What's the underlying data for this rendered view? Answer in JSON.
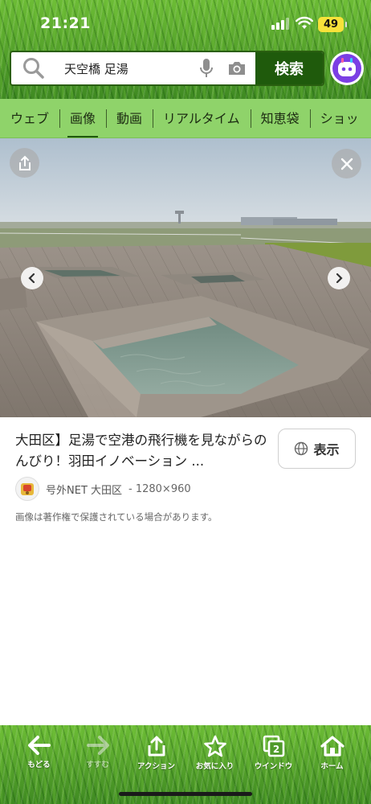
{
  "status_bar": {
    "time": "21:21",
    "battery": "49"
  },
  "search": {
    "query": "天空橋 足湯",
    "button_label": "検索"
  },
  "tabs": [
    {
      "label": "ウェブ",
      "active": false
    },
    {
      "label": "画像",
      "active": true
    },
    {
      "label": "動画",
      "active": false
    },
    {
      "label": "リアルタイム",
      "active": false
    },
    {
      "label": "知恵袋",
      "active": false
    },
    {
      "label": "ショッ",
      "active": false
    }
  ],
  "result": {
    "title": "大田区】足湯で空港の飛行機を見ながらのんびり！羽田イノベーション ...",
    "show_button_label": "表示",
    "source_name": "号外NET 大田区",
    "dimensions": "- 1280×960",
    "copyright_note": "画像は著作権で保護されている場合があります。"
  },
  "toolbar": {
    "back": "もどる",
    "forward": "すすむ",
    "action": "アクション",
    "favorites": "お気に入り",
    "window": "ウインドウ",
    "window_count": "2",
    "home": "ホーム"
  },
  "colors": {
    "brand_green": "#1f5a0c",
    "tab_bar": "#8fd36a"
  }
}
